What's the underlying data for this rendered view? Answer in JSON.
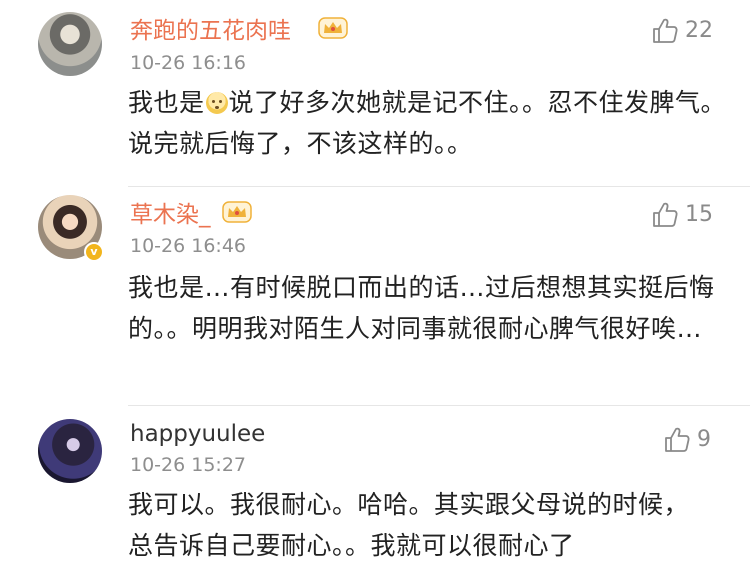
{
  "comments": [
    {
      "username": "奔跑的五花肉哇",
      "vip": true,
      "verified": false,
      "time": "10-26 16:16",
      "likes": "22",
      "text_before_emoji": "我也是",
      "emoji": "face-emoji",
      "text_after_emoji": "说了好多次她就是记不住。。忍不住发脾气。说完就后悔了，不该这样的。。"
    },
    {
      "username": "草木染_",
      "vip": true,
      "verified": true,
      "time": "10-26 16:46",
      "likes": "15",
      "text": "我也是…有时候脱口而出的话…过后想想其实挺后悔的。。明明我对陌生人对同事就很耐心脾气很好唉…"
    },
    {
      "username": "happyuulee",
      "vip": false,
      "verified": false,
      "time": "10-26 15:27",
      "likes": "9",
      "text": "我可以。我很耐心。哈哈。其实跟父母说的时候，总告诉自己要耐心。。我就可以很耐心了"
    }
  ],
  "colors": {
    "vip_name": "#eb7350",
    "plain_name": "#333333",
    "time": "#8e8e8e",
    "body_text": "#222222",
    "like": "#8a8a8a",
    "crown": "#f0b23a"
  }
}
